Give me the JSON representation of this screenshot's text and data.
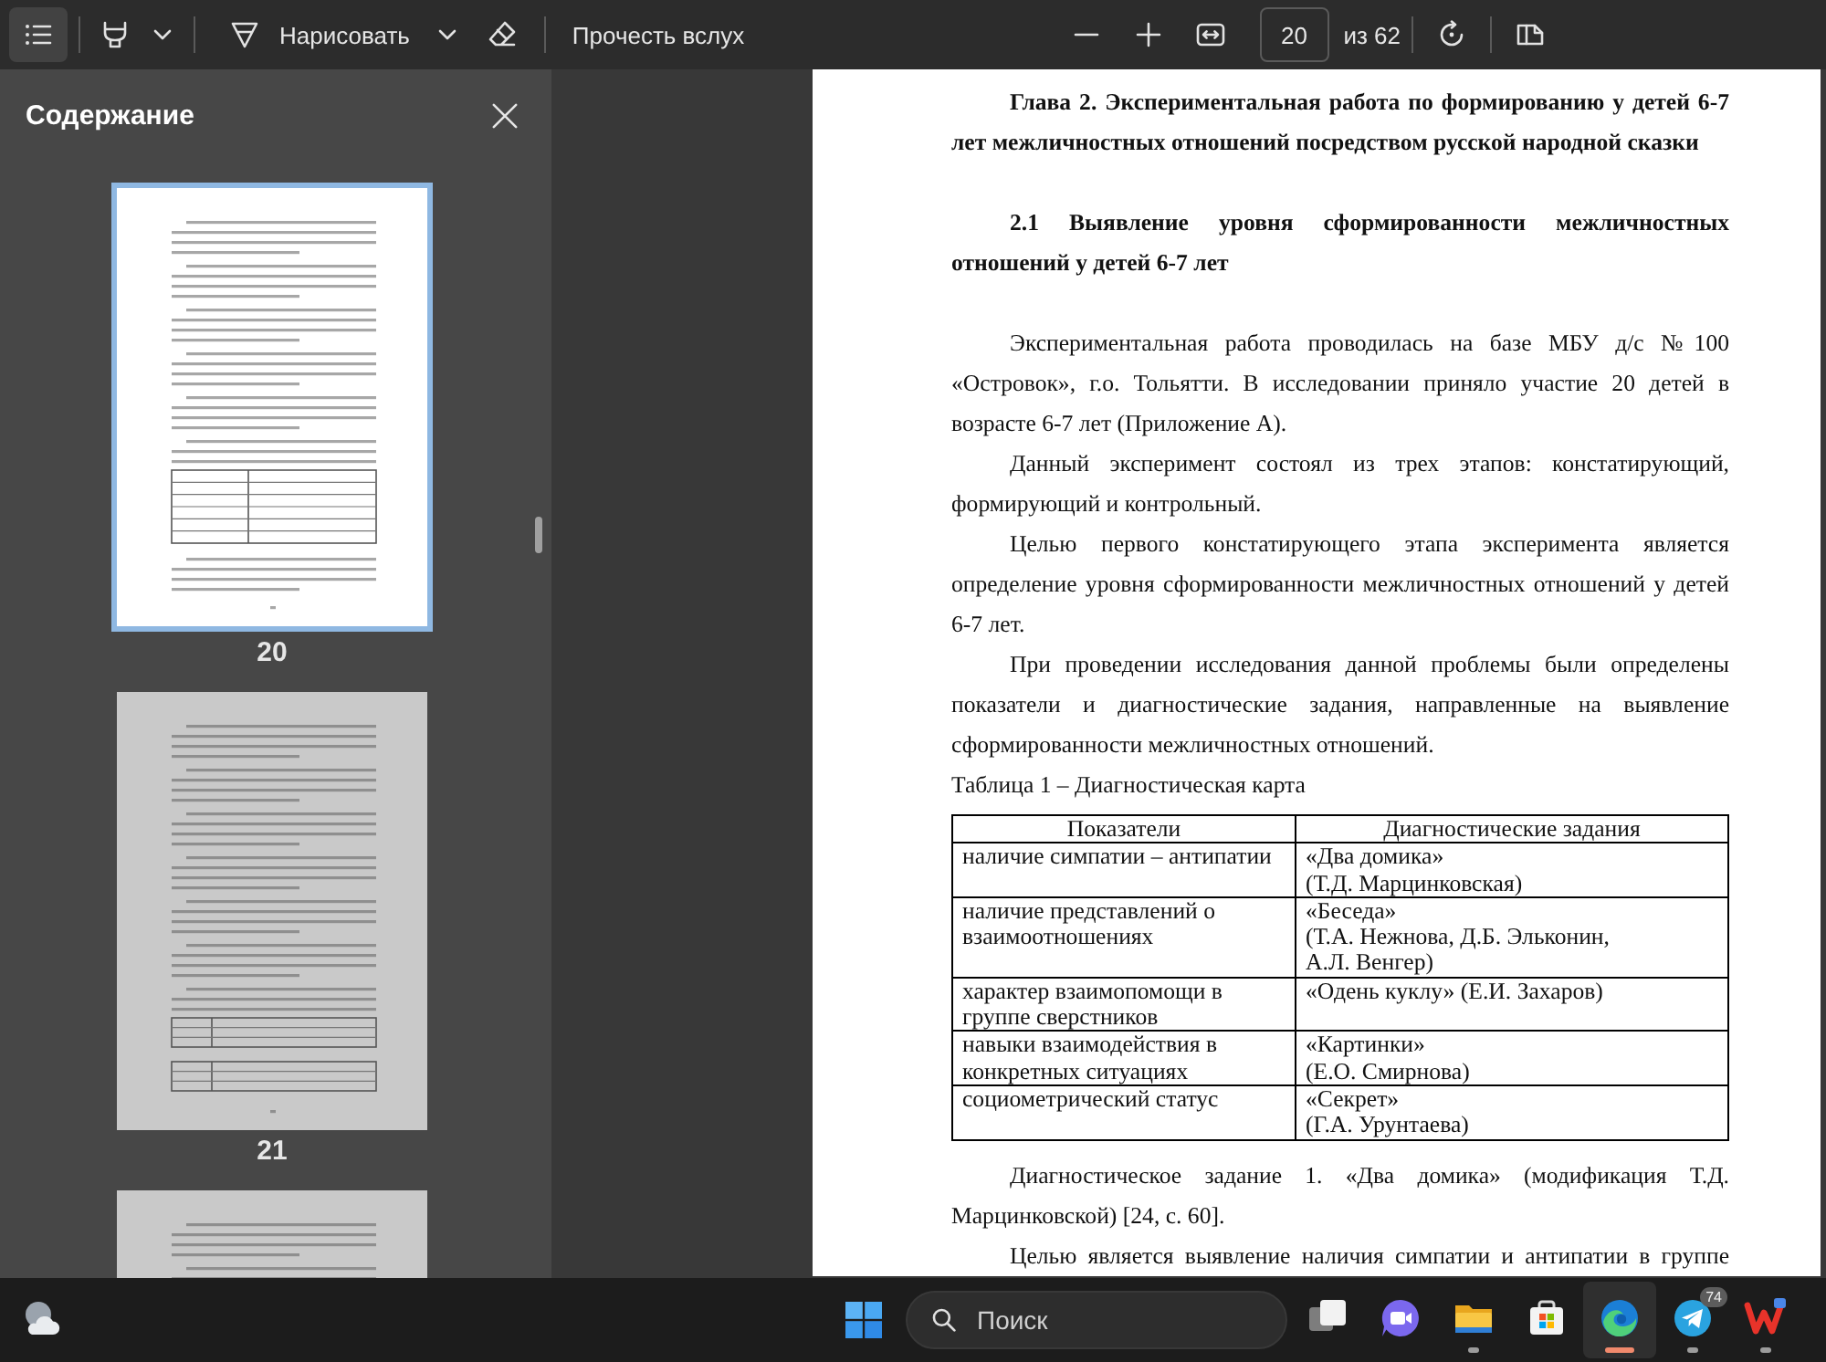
{
  "toolbar": {
    "contents_button": {
      "selected": true
    },
    "draw_button": {
      "label": "Нарисовать"
    },
    "read_aloud_button": {
      "label": "Прочесть вслух"
    },
    "page_field": {
      "value": "20"
    },
    "page_total": "из 62"
  },
  "sidebar": {
    "title": "Содержание",
    "thumbnails": [
      {
        "label": "20",
        "selected": true
      },
      {
        "label": "21",
        "selected": false
      },
      {
        "selected": false
      }
    ]
  },
  "document": {
    "blocks": [
      {
        "kind": "heading",
        "text": "Глава 2. Экспериментальная работа по формированию у детей 6-7 лет межличностных отношений посредством русской народной сказки"
      },
      {
        "kind": "heading",
        "text": "2.1 Выявление уровня сформированности межличностных отношений у детей 6-7 лет"
      },
      {
        "kind": "paragraph",
        "text": "Экспериментальная работа проводилась на базе МБУ д/с №100 «Островок», г.о. Тольятти. В исследовании приняло участие 20 детей в возрасте 6-7 лет (Приложение А)."
      },
      {
        "kind": "paragraph",
        "text": "Данный эксперимент состоял из трех этапов: констатирующий, формирующий и контрольный."
      },
      {
        "kind": "paragraph",
        "text": "Целью первого констатирующего этапа эксперимента является определение уровня сформированности межличностных отношений у детей 6-7 лет."
      },
      {
        "kind": "paragraph",
        "text": "При проведении исследования данной проблемы были определены показатели и диагностические задания, направленные на выявление сформированности межличностных отношений."
      },
      {
        "kind": "caption",
        "text": "Таблица 1 – Диагностическая карта"
      },
      {
        "kind": "table",
        "columns": [
          "Показатели",
          "Диагностические задания"
        ],
        "rows": [
          [
            "наличие симпатии – антипатии",
            "«Два домика»\n(Т.Д. Марцинковская)"
          ],
          [
            "наличие представлений о взаимоотношениях",
            "«Беседа»\n(Т.А. Нежнова, Д.Б. Эльконин,\nА.Л. Венгер)"
          ],
          [
            "характер взаимопомощи в группе сверстников",
            "«Одень куклу» (Е.И. Захаров)"
          ],
          [
            "навыки взаимодействия в конкретных ситуациях",
            "«Картинки»\n(Е.О. Смирнова)"
          ],
          [
            "социометрический статус",
            "«Секрет»\n(Г.А. Урунтаева)"
          ]
        ]
      },
      {
        "kind": "paragraph",
        "text": "Диагностическое задание 1. «Два домика» (модификация Т.Д. Марцинковской) [24, с. 60]."
      },
      {
        "kind": "paragraph",
        "text": "Целью является выявление наличия симпатии и антипатии в группе"
      }
    ]
  },
  "taskbar": {
    "search": {
      "placeholder": "Поиск"
    },
    "apps": [
      {
        "kind": "taskview",
        "running": false,
        "selected": false
      },
      {
        "kind": "chat",
        "running": false,
        "selected": false
      },
      {
        "kind": "files",
        "running": true,
        "selected": false
      },
      {
        "kind": "store",
        "running": false,
        "selected": false
      },
      {
        "kind": "browser",
        "running": true,
        "selected": true
      },
      {
        "kind": "messenger",
        "running": true,
        "selected": false,
        "badge": "74"
      },
      {
        "kind": "office",
        "running": true,
        "selected": false
      }
    ]
  }
}
